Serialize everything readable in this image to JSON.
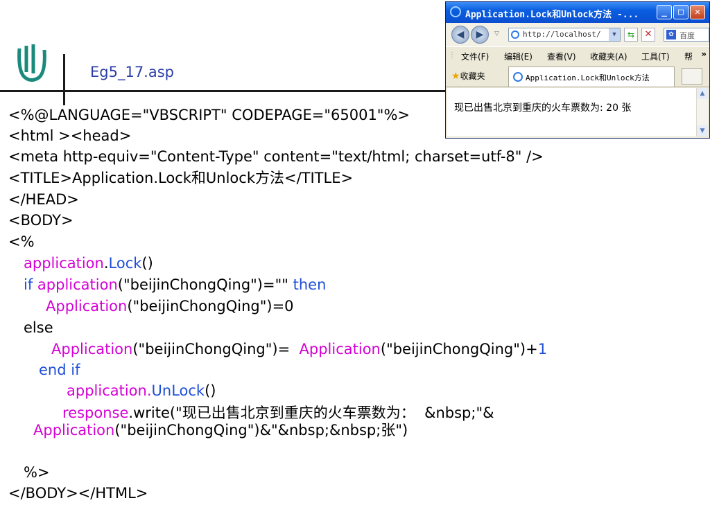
{
  "slide": {
    "title": "Eg5_17.asp"
  },
  "code": {
    "l1": "<%@LANGUAGE=\"VBSCRIPT\" CODEPAGE=\"65001\"%>",
    "l2": "<html ><head>",
    "l3": "<meta http-equiv=\"Content-Type\" content=\"text/html; charset=utf-8\" />",
    "l4a": "<TITLE>Application.Lock",
    "l4b": "和",
    "l4c": "Unlock",
    "l4d": "方法",
    "l4e": "</TITLE>",
    "l5": "</HEAD>",
    "l6": "<BODY>",
    "l7": "<%",
    "l8a": "application",
    "l8b": ".",
    "l8c": "Lock",
    "l8d": "()",
    "l9a": "if",
    "l9b": "application",
    "l9c": "(\"beijinChongQing\")=\"\"",
    "l9d": "then",
    "l10a": "Application",
    "l10b": "(\"beijinChongQing\")=0",
    "l11": "else",
    "l12a": "Application",
    "l12b": "(\"beijinChongQing\")=",
    "l12c": "Application",
    "l12d": "(\"beijinChongQing\")+",
    "l12e": "1",
    "l13": "end if",
    "l14a": "application.",
    "l14b": "UnLock",
    "l14c": "()",
    "l15a": "response",
    "l15b": ".write(\"",
    "l15c": "现已出售北京到重庆的火车票数为：",
    "l15d": "&nbsp;\"&",
    "l16a": "Application",
    "l16b": "(\"beijinChongQing\")&\"&nbsp;&nbsp;",
    "l16c": "张",
    "l16d": "\")",
    "l17": "%>",
    "l18": "</BODY></HTML>"
  },
  "browser": {
    "window_title": "Application.Lock和Unlock方法 -...",
    "address": "http://localhost/",
    "search_placeholder": "百度",
    "menu": [
      "文件(F)",
      "编辑(E)",
      "查看(V)",
      "收藏夹(A)",
      "工具(T)",
      "帮"
    ],
    "favorites_label": "收藏夹",
    "tab_title": "Application.Lock和Unlock方法",
    "content_text": "现已出售北京到重庆的火车票数为:  20  张"
  },
  "colors": {
    "keyword_magenta": "#d400d4",
    "keyword_blue": "#1f4fd8",
    "title_blue": "#2b3ea6"
  }
}
